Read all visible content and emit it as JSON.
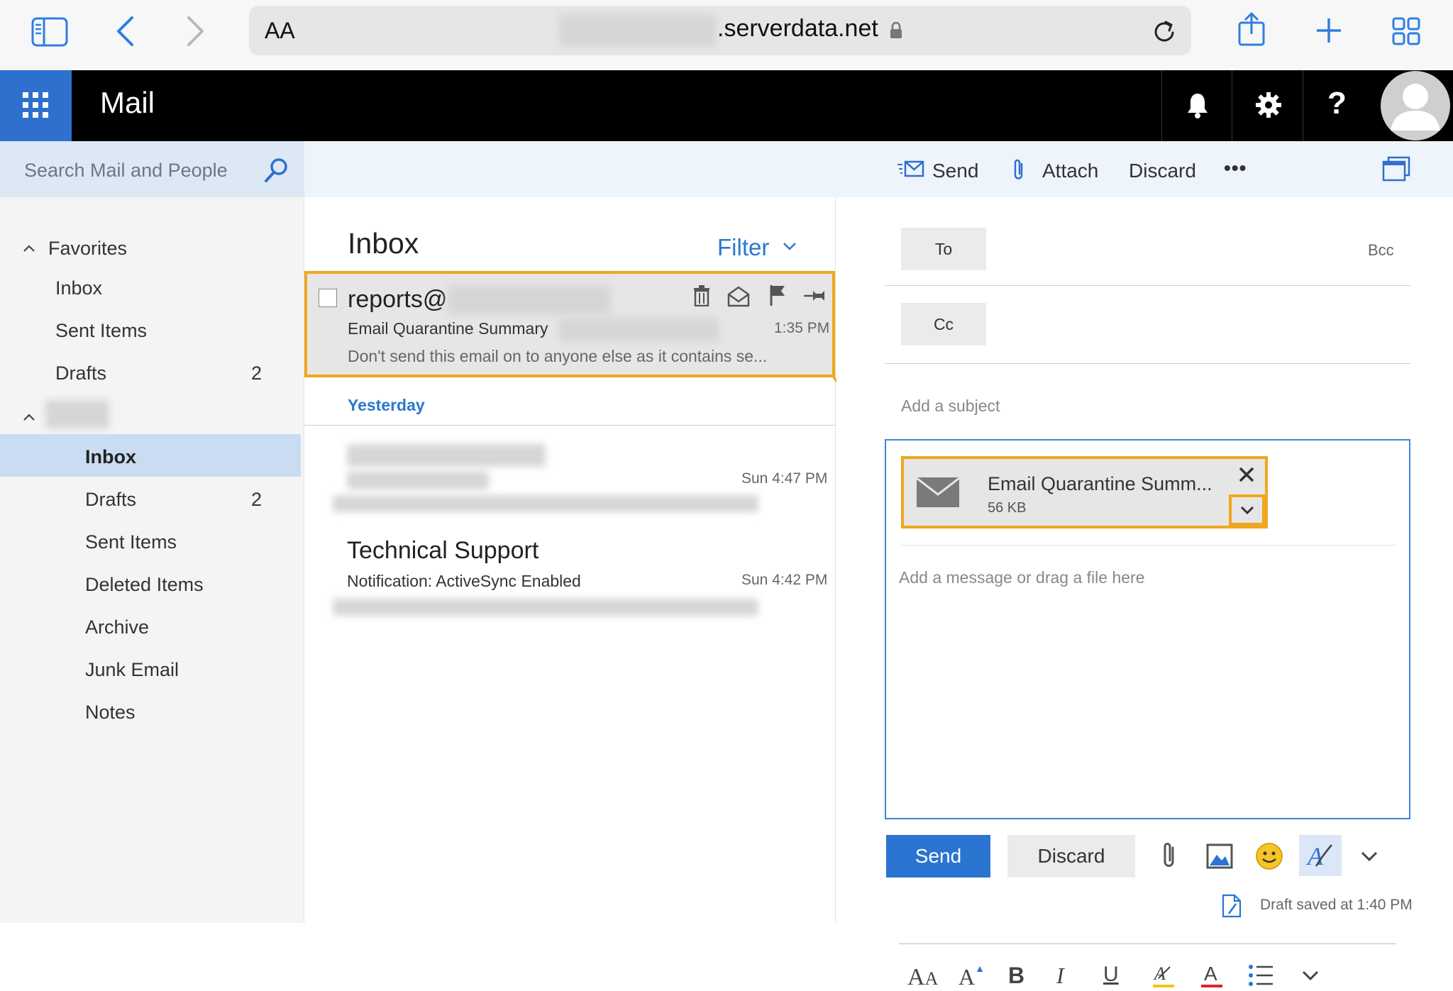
{
  "browser": {
    "text_size_label": "AA",
    "url_suffix": ".serverdata.net"
  },
  "header": {
    "app_title": "Mail"
  },
  "search": {
    "placeholder": "Search Mail and People"
  },
  "toolbar": {
    "send_label": "Send",
    "attach_label": "Attach",
    "discard_label": "Discard",
    "more_label": "•••"
  },
  "nav": {
    "favorites_label": "Favorites",
    "favorites": [
      {
        "label": "Inbox",
        "count": ""
      },
      {
        "label": "Sent Items",
        "count": ""
      },
      {
        "label": "Drafts",
        "count": "2"
      }
    ],
    "folders": [
      {
        "label": "Inbox",
        "count": ""
      },
      {
        "label": "Drafts",
        "count": "2"
      },
      {
        "label": "Sent Items",
        "count": ""
      },
      {
        "label": "Deleted Items",
        "count": ""
      },
      {
        "label": "Archive",
        "count": ""
      },
      {
        "label": "Junk Email",
        "count": ""
      },
      {
        "label": "Notes",
        "count": ""
      }
    ]
  },
  "list": {
    "title": "Inbox",
    "filter_label": "Filter",
    "group_yesterday": "Yesterday",
    "messages": [
      {
        "sender": "reports@",
        "subject": "Email Quarantine Summary",
        "time": "1:35 PM",
        "preview": "Don't send this email on to anyone else as it contains se..."
      },
      {
        "sender": "",
        "subject": "",
        "time": "Sun 4:47 PM",
        "preview": ""
      },
      {
        "sender": "Technical Support",
        "subject": "Notification: ActiveSync Enabled",
        "time": "Sun 4:42 PM",
        "preview": ""
      }
    ]
  },
  "compose": {
    "to_label": "To",
    "cc_label": "Cc",
    "bcc_label": "Bcc",
    "subject_placeholder": "Add a subject",
    "attachment": {
      "name": "Email Quarantine Summ...",
      "size": "56 KB"
    },
    "body_placeholder": "Add a message or drag a file here",
    "send_label": "Send",
    "discard_label": "Discard",
    "draft_status": "Draft saved at 1:40 PM"
  },
  "colors": {
    "accent": "#2b74d1",
    "highlight": "#f0a71e",
    "header_bg": "#000000",
    "selected_folder": "#c9dcf1"
  }
}
